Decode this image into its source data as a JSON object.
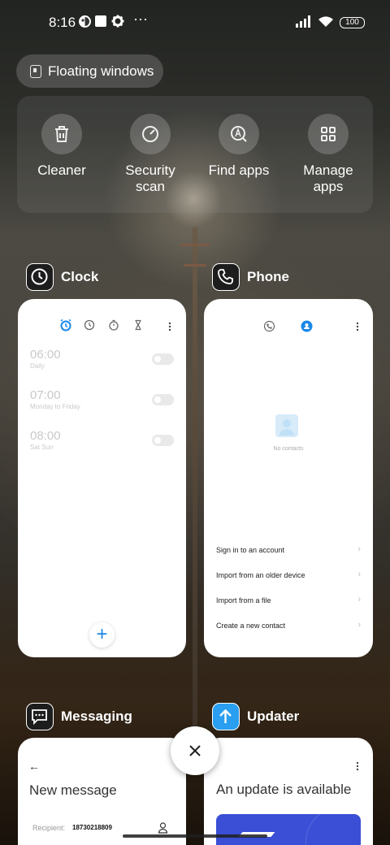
{
  "status_bar": {
    "time": "8:16",
    "overflow": "⋯",
    "battery": "100",
    "icons": [
      "game-icon",
      "square-app-icon",
      "gear-icon",
      "signal-icon",
      "wifi-icon",
      "battery-icon"
    ]
  },
  "floating_windows": {
    "label": "Floating windows",
    "icon": "floating-window-icon"
  },
  "quick_actions": [
    {
      "label": "Cleaner",
      "icon": "trash-icon"
    },
    {
      "label": "Security\nscan",
      "icon": "security-scan-icon"
    },
    {
      "label": "Find apps",
      "icon": "find-apps-icon"
    },
    {
      "label": "Manage\napps",
      "icon": "grid-icon"
    }
  ],
  "apps": {
    "clock": {
      "name": "Clock",
      "alarms": [
        {
          "time": "06:00",
          "days": "Daily",
          "enabled": false
        },
        {
          "time": "07:00",
          "days": "Monday to Friday",
          "enabled": false
        },
        {
          "time": "08:00",
          "days": "Sat Sun",
          "enabled": false
        }
      ],
      "add": "+"
    },
    "phone": {
      "name": "Phone",
      "empty_text": "No contacts",
      "options": [
        "Sign in to an account",
        "Import from an older device",
        "Import from a file",
        "Create a new contact"
      ]
    },
    "messaging": {
      "name": "Messaging",
      "back": "←",
      "title": "New message",
      "recipient_label": "Recipient:",
      "recipient_value": "18730218809"
    },
    "updater": {
      "name": "Updater",
      "title": "An update is available"
    }
  },
  "colors": {
    "accent": "#1a88e8",
    "updater": "#2a9ef0",
    "banner": "#3a4fd6"
  }
}
